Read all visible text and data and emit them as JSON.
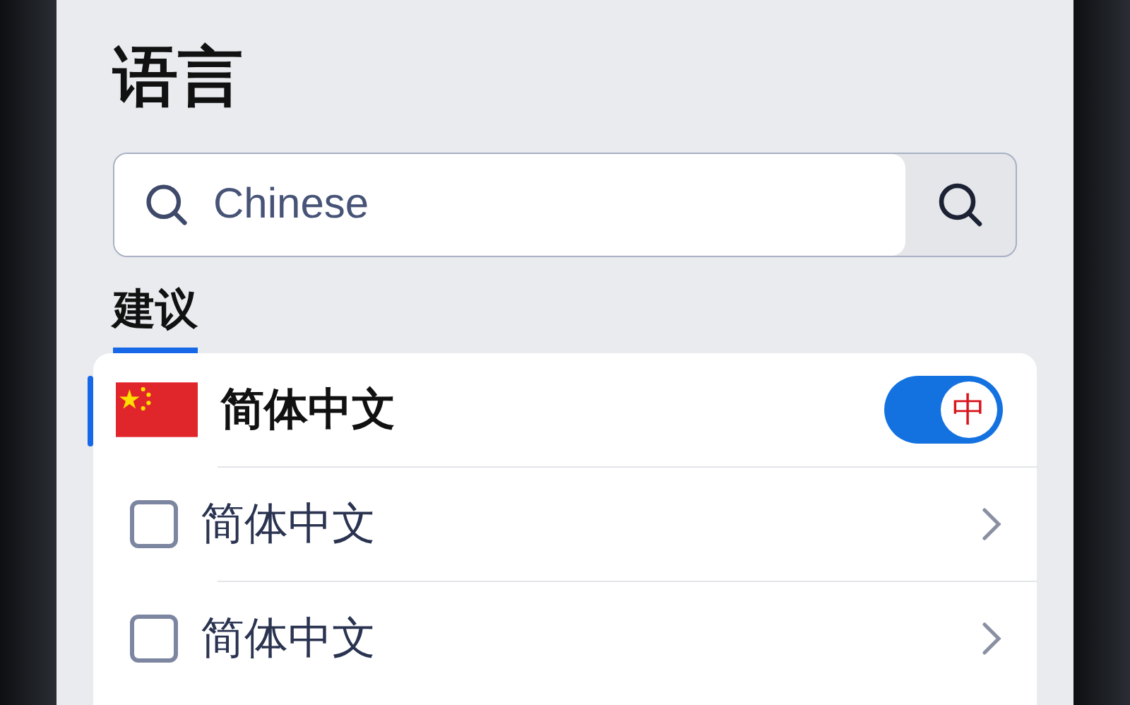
{
  "title": "语言",
  "search": {
    "value": "Chinese"
  },
  "tabs": [
    {
      "label": "建议",
      "selected": true
    }
  ],
  "languages": [
    {
      "kind": "toggle",
      "name": "简体中文",
      "selected": true,
      "on": true,
      "toggle_label": "中"
    },
    {
      "kind": "checkbox",
      "name": "简体中文",
      "selected": false,
      "checked": false
    },
    {
      "kind": "checkbox",
      "name": "简体中文",
      "selected": false,
      "checked": false
    }
  ]
}
